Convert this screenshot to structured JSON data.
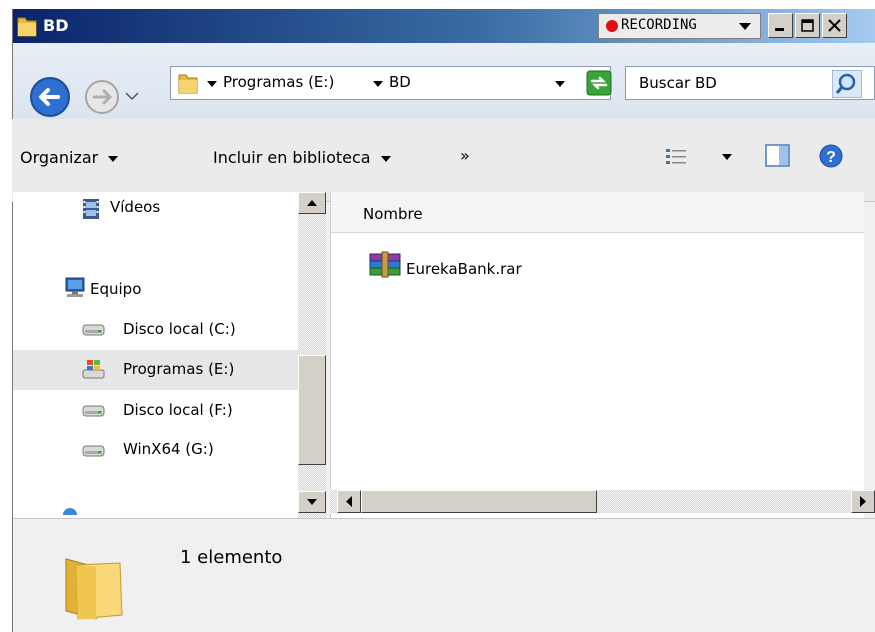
{
  "window": {
    "title": "BD"
  },
  "recording": {
    "label": "RECORDING"
  },
  "address": {
    "crumbs": [
      "Programas (E:)",
      "BD"
    ]
  },
  "search": {
    "placeholder": "Buscar BD"
  },
  "toolbar": {
    "organize_label": "Organizar",
    "include_label": "Incluir en biblioteca",
    "more_label": "»"
  },
  "sidebar": {
    "items": [
      {
        "label": "Vídeos",
        "icon": "video-library-icon"
      },
      {
        "label": "Equipo",
        "icon": "computer-icon"
      },
      {
        "label": "Disco local (C:)",
        "icon": "drive-icon"
      },
      {
        "label": "Programas (E:)",
        "icon": "windows-drive-icon",
        "selected": true
      },
      {
        "label": "Disco local (F:)",
        "icon": "drive-icon"
      },
      {
        "label": "WinX64 (G:)",
        "icon": "drive-icon"
      }
    ]
  },
  "list": {
    "column_name": "Nombre",
    "files": [
      {
        "name": "EurekaBank.rar",
        "icon": "winrar-archive-icon"
      }
    ]
  },
  "details": {
    "count": "1 elemento"
  },
  "colors": {
    "titlebar_start": "#0a246a",
    "titlebar_end": "#a6caf0",
    "selection": "#e6e6e6"
  }
}
